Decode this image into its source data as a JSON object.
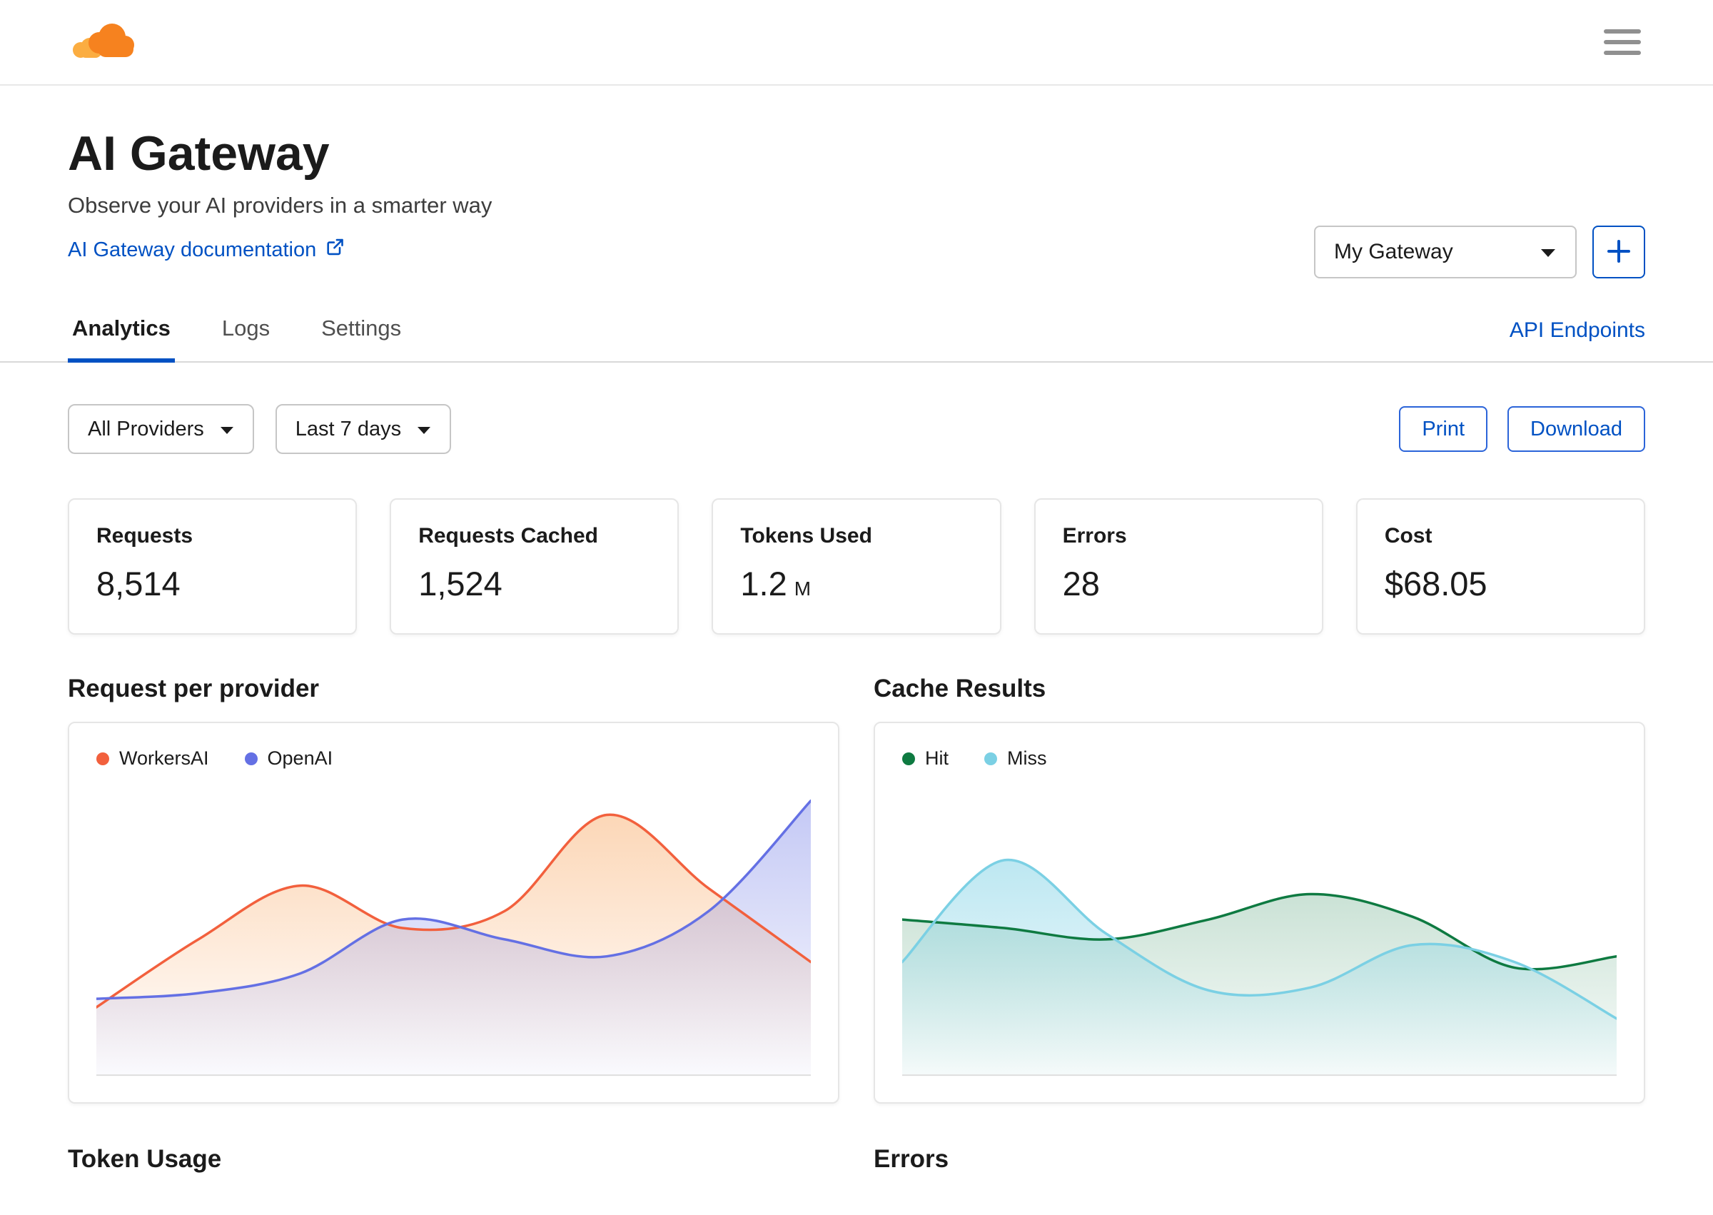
{
  "topbar": {
    "logo": "cloudflare-cloud",
    "menu_icon": "hamburger-menu"
  },
  "header": {
    "title": "AI Gateway",
    "subtitle": "Observe your AI providers in a smarter way",
    "doc_link_label": "AI Gateway documentation",
    "gateway_selector_value": "My Gateway",
    "add_gateway_icon": "plus"
  },
  "tabs": {
    "items": [
      {
        "label": "Analytics",
        "active": true
      },
      {
        "label": "Logs",
        "active": false
      },
      {
        "label": "Settings",
        "active": false
      }
    ],
    "api_endpoints_label": "API Endpoints"
  },
  "filters": {
    "providers_dropdown_value": "All Providers",
    "date_range_dropdown_value": "Last 7 days",
    "print_button_label": "Print",
    "download_button_label": "Download"
  },
  "stats": [
    {
      "label": "Requests",
      "value": "8,514"
    },
    {
      "label": "Requests Cached",
      "value": "1,524"
    },
    {
      "label": "Tokens Used",
      "value": "1.2",
      "suffix": "M"
    },
    {
      "label": "Errors",
      "value": "28"
    },
    {
      "label": "Cost",
      "value": "$68.05"
    }
  ],
  "colors": {
    "accent_blue": "#0051c3",
    "brand_orange": "#f6821f",
    "border_gray": "#e6e6e6"
  },
  "chart_data": [
    {
      "type": "area",
      "title": "Request per provider",
      "x_labels": [],
      "grid": false,
      "legend_position": "top-left",
      "y_units": "relative-percent-of-plot-height",
      "ylim": [
        0,
        100
      ],
      "series": [
        {
          "name": "WorkersAI",
          "color": "#f2603d",
          "fill_from": "rgba(246,130,31,0.32)",
          "fill_to": "rgba(246,130,31,0)",
          "values": [
            24,
            48,
            67,
            52,
            58,
            92,
            66,
            40
          ]
        },
        {
          "name": "OpenAI",
          "color": "#6470e4",
          "fill_from": "rgba(100,112,228,0.38)",
          "fill_to": "rgba(100,112,228,0.03)",
          "values": [
            27,
            29,
            36,
            55,
            48,
            42,
            58,
            97
          ]
        }
      ]
    },
    {
      "type": "area",
      "title": "Cache Results",
      "x_labels": [],
      "grid": false,
      "legend_position": "top-left",
      "y_units": "relative-percent-of-plot-height",
      "ylim": [
        0,
        100
      ],
      "series": [
        {
          "name": "Hit",
          "color": "#0e7a41",
          "fill_from": "rgba(14,122,65,0.22)",
          "fill_to": "rgba(14,122,65,0.02)",
          "values": [
            55,
            52,
            48,
            55,
            64,
            56,
            38,
            42
          ]
        },
        {
          "name": "Miss",
          "color": "#7bd0e4",
          "fill_from": "rgba(123,208,228,0.50)",
          "fill_to": "rgba(123,208,228,0.04)",
          "values": [
            40,
            76,
            50,
            30,
            31,
            46,
            40,
            20
          ]
        }
      ]
    }
  ],
  "bottom_sections": {
    "left_title": "Token Usage",
    "right_title": "Errors"
  }
}
